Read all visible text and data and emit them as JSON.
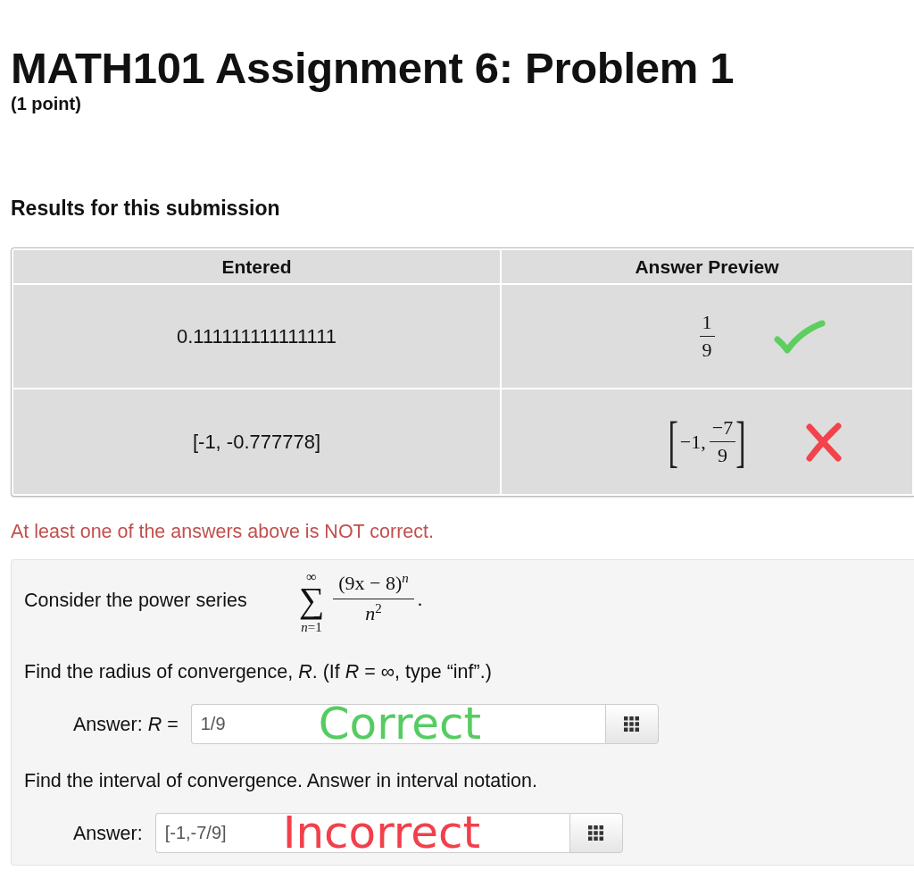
{
  "header": {
    "title": "MATH101 Assignment 6: Problem 1",
    "points": "(1 point)"
  },
  "results": {
    "heading": "Results for this submission",
    "table": {
      "columns": [
        "Entered",
        "Answer Preview"
      ],
      "rows": [
        {
          "entered": "0.111111111111111",
          "preview": {
            "kind": "fraction",
            "numerator": "1",
            "denominator": "9"
          },
          "correct": true
        },
        {
          "entered": "[-1, -0.777778]",
          "preview": {
            "kind": "interval",
            "open": "[",
            "left": "−1,",
            "numerator": "−7",
            "denominator": "9",
            "close": "]"
          },
          "correct": false
        }
      ]
    },
    "message": "At least one of the answers above is NOT correct."
  },
  "problem": {
    "intro": "Consider the power series",
    "series": {
      "upper": "∞",
      "symbol": "∑",
      "lower": "*n*=1",
      "numerator": "(9x − 8)$^{n}$",
      "denominator": "*n*$^{2}$",
      "end": "."
    },
    "parts": [
      {
        "prompt": "Find the radius of convergence, *R*. (If *R* = ∞, type “inf”.)",
        "answer": {
          "label": "Answer: *R* =",
          "value": "1/9",
          "annotation": "Correct",
          "correct": true
        }
      },
      {
        "prompt": "Find the interval of convergence. Answer in interval notation.",
        "answer": {
          "label": "Answer:",
          "value": "[-1,-7/9]",
          "annotation": "Incorrect",
          "correct": false
        }
      }
    ]
  }
}
